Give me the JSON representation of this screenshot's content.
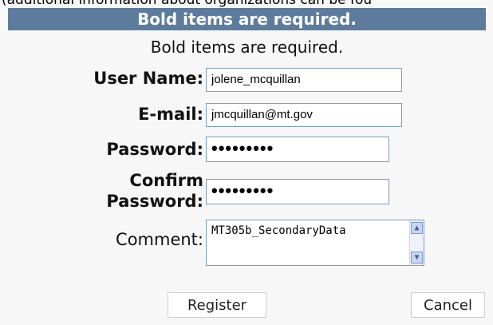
{
  "top_text": "(additional information about organizations can be fou",
  "header": {
    "title": "Bold items are required."
  },
  "subtitle": "Bold items are required.",
  "form": {
    "username": {
      "label": "User Name:",
      "value": "jolene_mcquillan"
    },
    "email": {
      "label": "E-mail:",
      "value": "jmcquillan@mt.gov"
    },
    "password": {
      "label": "Password:",
      "value": "•••••••••"
    },
    "confirm": {
      "label_line1": "Confirm",
      "label_line2": "Password:",
      "value": "•••••••••"
    },
    "comment": {
      "label": "Comment:",
      "value": "MT305b_SecondaryData"
    }
  },
  "icons": {
    "scroll_up": "scroll-up-arrow",
    "scroll_down": "scroll-down-arrow"
  },
  "buttons": {
    "register": "Register",
    "cancel": "Cancel"
  },
  "colors": {
    "header_bg": "#5d7b9d",
    "input_border": "#7f9db9"
  }
}
